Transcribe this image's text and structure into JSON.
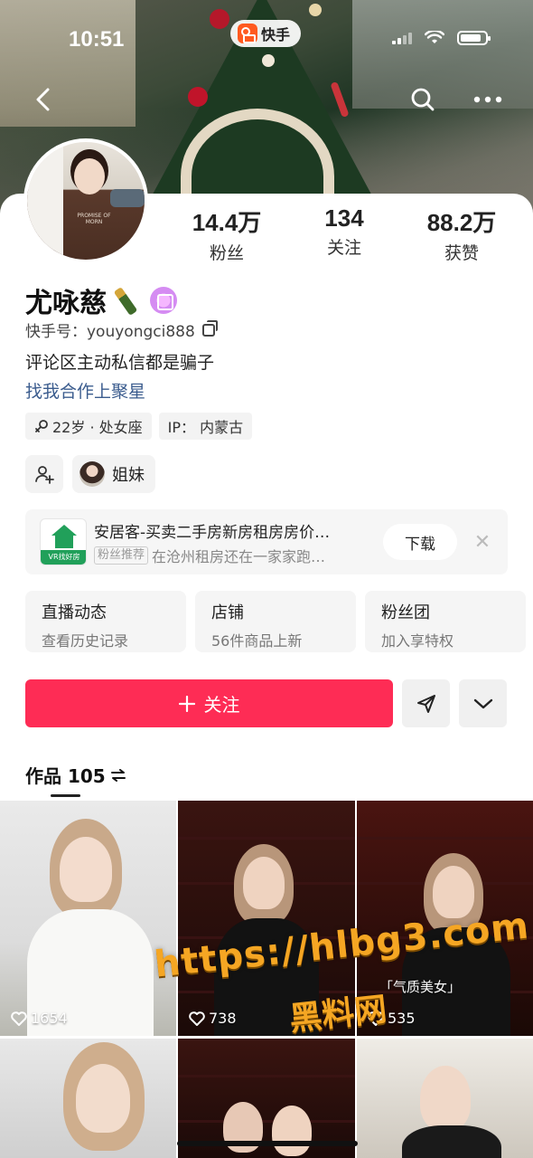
{
  "status_bar": {
    "time": "10:51",
    "app_pill": "快手"
  },
  "profile": {
    "name": "尤咏慈",
    "kuaishou_id": "快手号：youyongci888",
    "bio": "评论区主动私信都是骗子",
    "bio_link": "找我合作上聚星",
    "stats": [
      {
        "num": "14.4万",
        "label": "粉丝"
      },
      {
        "num": "134",
        "label": "关注"
      },
      {
        "num": "88.2万",
        "label": "获赞"
      }
    ],
    "tags": [
      {
        "icon": "female-icon",
        "text": "22岁 · 处女座"
      },
      {
        "text": "IP：  内蒙古"
      }
    ],
    "friend_label": "姐妹"
  },
  "ad": {
    "title": "安居客-买卖二手房新房租房房价…",
    "tag": "粉丝推荐",
    "subtitle": "在沧州租房还在一家家跑…",
    "icon_text": "VR找好房",
    "download": "下载"
  },
  "features": [
    {
      "title": "直播动态",
      "sub": "查看历史记录"
    },
    {
      "title": "店铺",
      "sub": "56件商品上新"
    },
    {
      "title": "粉丝团",
      "sub": "加入享特权"
    }
  ],
  "actions": {
    "follow": "关注"
  },
  "works": {
    "label": "作品 105",
    "items": [
      {
        "likes": "1654"
      },
      {
        "likes": "738"
      },
      {
        "likes": "535"
      }
    ],
    "caption": "「气质美女」"
  },
  "watermark": {
    "url": "https://hlbg3.com",
    "name": "黑料网"
  },
  "colors": {
    "accent": "#fe2c55",
    "link": "#3b5c8e"
  }
}
